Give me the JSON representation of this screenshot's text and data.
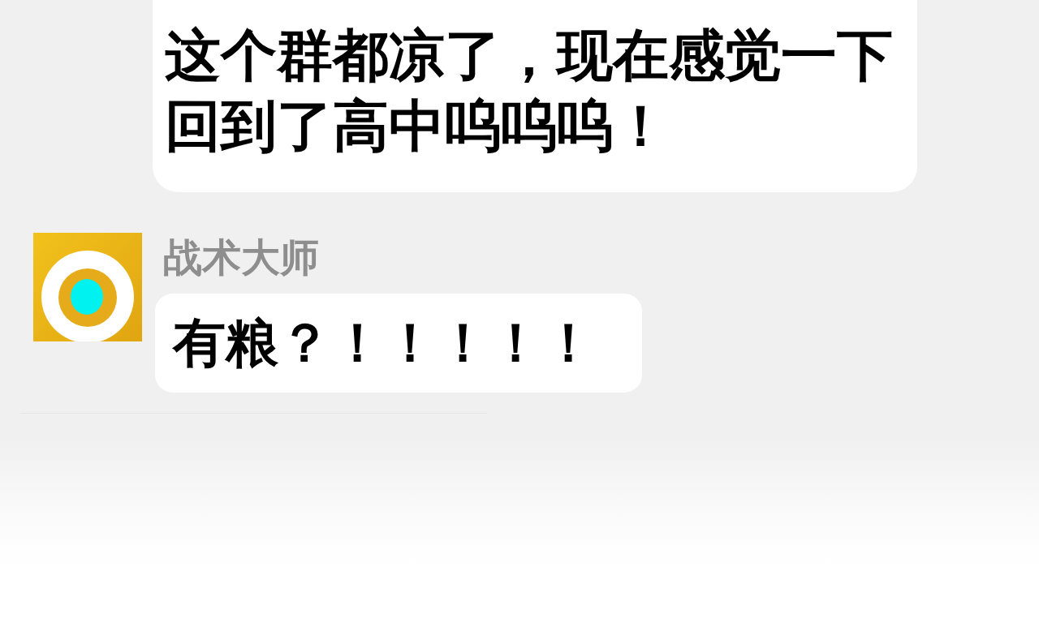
{
  "messages": [
    {
      "kind": "continued",
      "text": "这个群都凉了，现在感觉一下回到了高中呜呜呜！"
    },
    {
      "kind": "incoming",
      "sender": "战术大师",
      "text": "有粮？！！！！！"
    }
  ]
}
